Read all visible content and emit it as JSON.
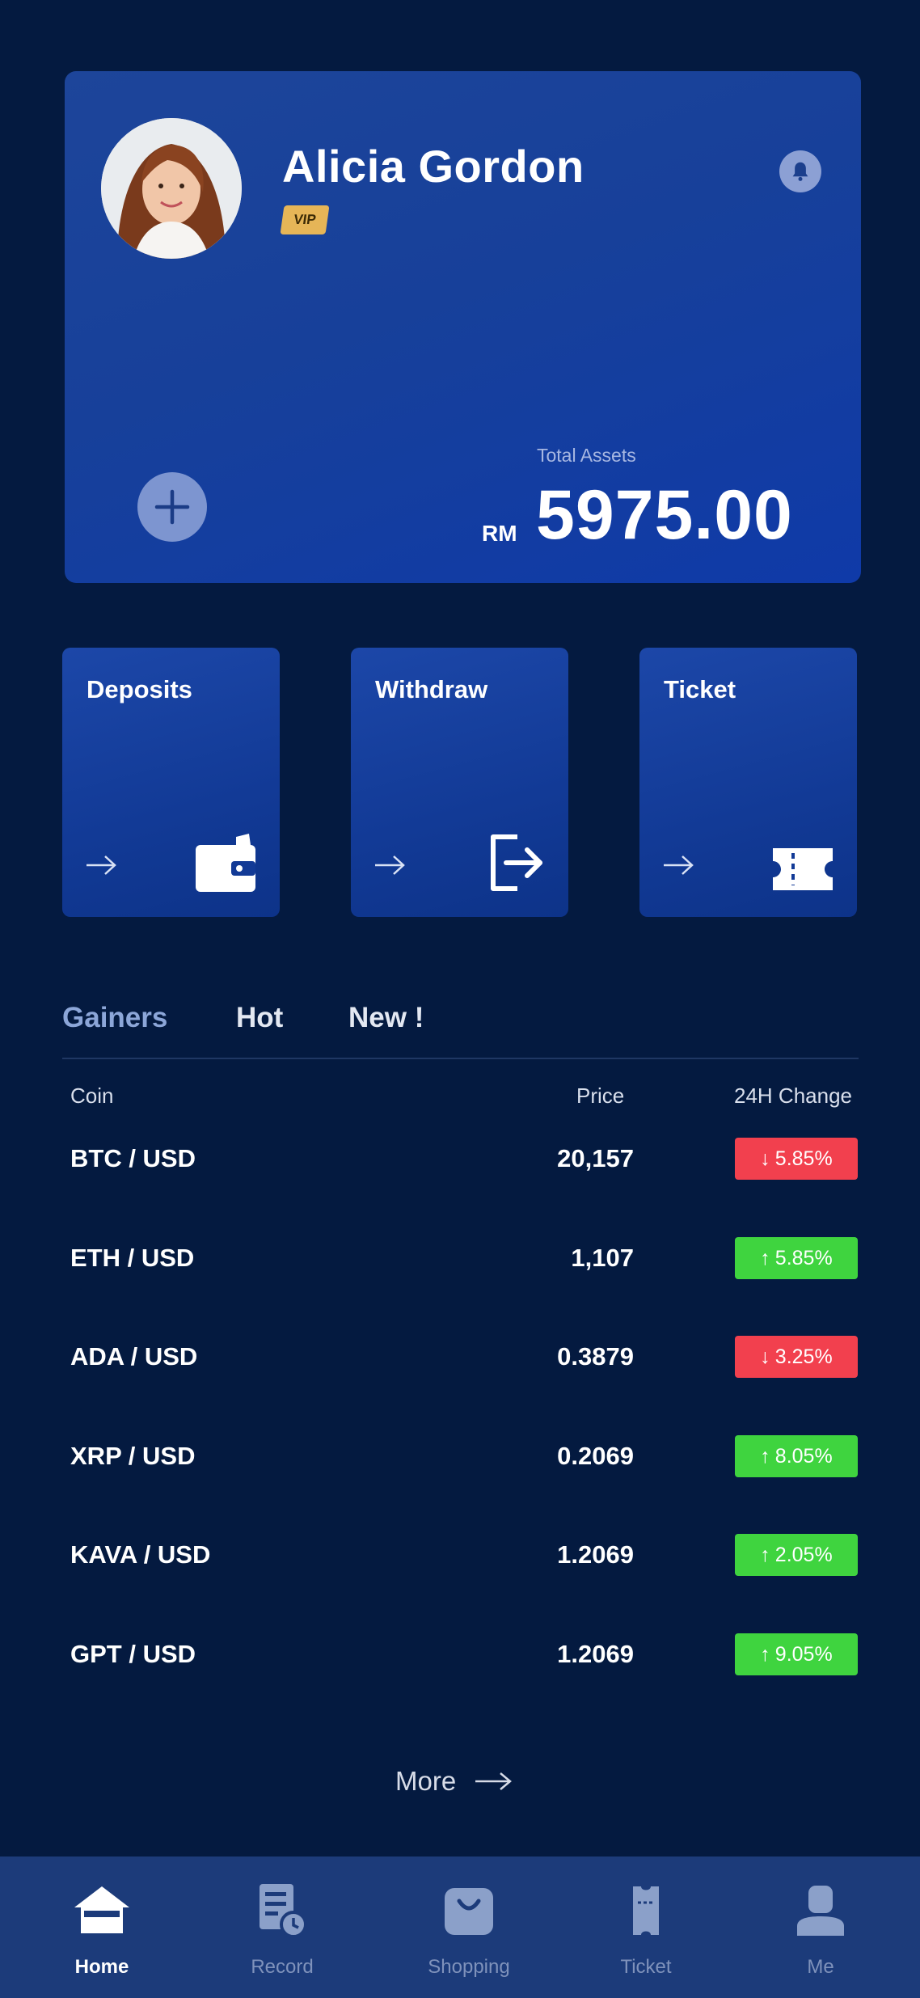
{
  "profile": {
    "name": "Alicia Gordon",
    "badge": "VIP",
    "assets_label": "Total Assets",
    "currency": "RM",
    "amount": "5975.00"
  },
  "actions": [
    {
      "label": "Deposits",
      "icon": "wallet-icon"
    },
    {
      "label": "Withdraw",
      "icon": "logout-icon"
    },
    {
      "label": "Ticket",
      "icon": "ticket-icon"
    }
  ],
  "tabs": [
    "Gainers",
    "Hot",
    "New !"
  ],
  "active_tab": "Gainers",
  "table": {
    "headers": {
      "coin": "Coin",
      "price": "Price",
      "change": "24H Change"
    },
    "rows": [
      {
        "coin": "BTC / USD",
        "price": "20,157",
        "change": "5.85%",
        "direction": "down",
        "arrow": "↓"
      },
      {
        "coin": "ETH / USD",
        "price": "1,107",
        "change": "5.85%",
        "direction": "up",
        "arrow": "↑"
      },
      {
        "coin": "ADA / USD",
        "price": "0.3879",
        "change": "3.25%",
        "direction": "down",
        "arrow": "↓"
      },
      {
        "coin": "XRP / USD",
        "price": "0.2069",
        "change": "8.05%",
        "direction": "up",
        "arrow": "↑"
      },
      {
        "coin": "KAVA / USD",
        "price": "1.2069",
        "change": "2.05%",
        "direction": "up",
        "arrow": "↑"
      },
      {
        "coin": "GPT / USD",
        "price": "1.2069",
        "change": "9.05%",
        "direction": "up",
        "arrow": "↑"
      }
    ]
  },
  "more_label": "More",
  "nav": [
    {
      "label": "Home",
      "icon": "home-icon",
      "active": true
    },
    {
      "label": "Record",
      "icon": "record-icon",
      "active": false
    },
    {
      "label": "Shopping",
      "icon": "shopping-bag-icon",
      "active": false
    },
    {
      "label": "Ticket",
      "icon": "ticket-nav-icon",
      "active": false
    },
    {
      "label": "Me",
      "icon": "person-icon",
      "active": false
    }
  ],
  "colors": {
    "background": "#041a40",
    "card": "#17409a",
    "down": "#f2404e",
    "up": "#3fd43f",
    "nav": "#1c3b7a",
    "vip": "#e6b557"
  }
}
